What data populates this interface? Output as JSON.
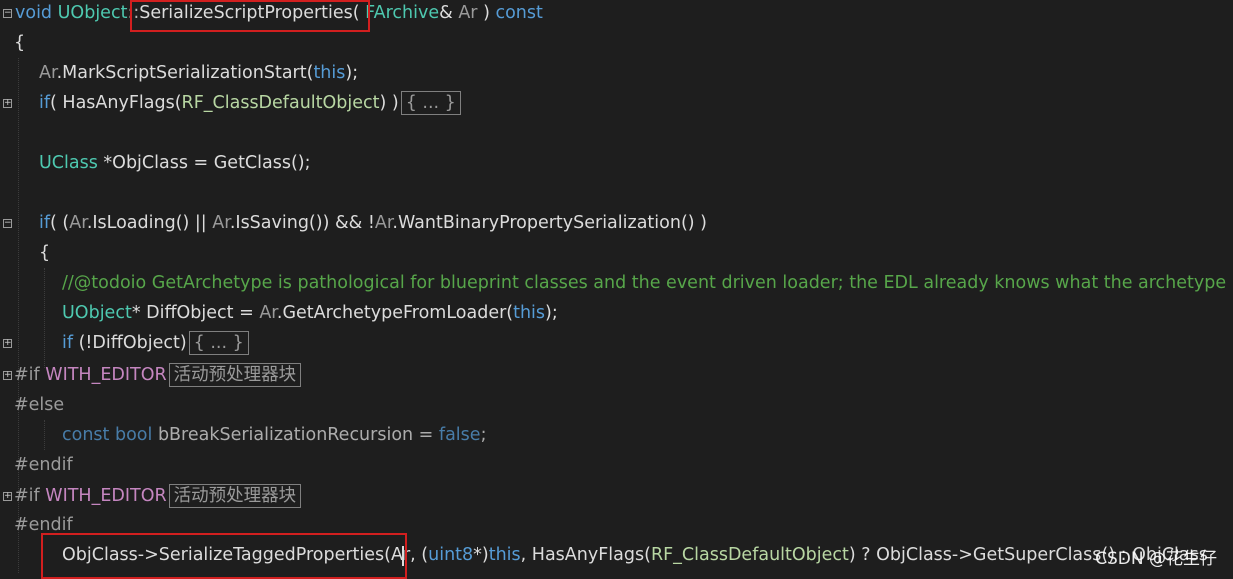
{
  "lines": {
    "l1": {
      "void": "void",
      "class": "UObject",
      "sep": "::",
      "method": "SerializeScriptProperties",
      "open": "( ",
      "ptype": "FArchive",
      "amp": "& ",
      "param": "Ar",
      "close": " ) ",
      "const": "const"
    },
    "l2": {
      "brace": "{"
    },
    "l3": {
      "obj": "Ar",
      "call": ".MarkScriptSerializationStart(",
      "this": "this",
      "end": ");"
    },
    "l4": {
      "if": "if",
      "open": "( HasAnyFlags(",
      "flag": "RF_ClassDefaultObject",
      "close": ") )",
      "collapsed": "{ ... }"
    },
    "l5": {
      "type": "UClass",
      "rest": " *ObjClass = GetClass();"
    },
    "l6": {
      "if": "if",
      "a": "( (",
      "ar1": "Ar",
      "b": ".IsLoading() || ",
      "ar2": "Ar",
      "c": ".IsSaving()) && !",
      "ar3": "Ar",
      "d": ".WantBinaryPropertySerialization() )"
    },
    "l7": {
      "brace": "{"
    },
    "l8": {
      "comment": "//@todoio GetArchetype is pathological for blueprint classes and the event driven loader; the EDL already knows what the archetype is"
    },
    "l9": {
      "type": "UObject",
      "a": "* DiffObject = ",
      "ar": "Ar",
      "b": ".GetArchetypeFromLoader(",
      "this": "this",
      "c": ");"
    },
    "l10": {
      "if": "if",
      "rest": " (!DiffObject)",
      "collapsed": "{ ... }"
    },
    "l11": {
      "directive": "#if",
      "macro": "WITH_EDITOR",
      "collapsed": "活动预处理器块"
    },
    "l12": {
      "directive": "#else"
    },
    "l13": {
      "const": "const",
      "bool": "bool",
      "name": " bBreakSerializationRecursion = ",
      "false": "false",
      "end": ";"
    },
    "l14": {
      "directive": "#endif"
    },
    "l15": {
      "directive": "#if",
      "macro": "WITH_EDITOR",
      "collapsed": "活动预处理器块"
    },
    "l16": {
      "directive": "#endif"
    },
    "l17": {
      "a": "ObjClass->SerializeTaggedProperties",
      "b": "(Ar, (",
      "uint8": "uint8",
      "c": "*)",
      "this": "this",
      "d": ", HasAnyFlags(",
      "flag": "RF_ClassDefaultObject",
      "e": ") ? ObjClass->GetSuperClass() : ObjClass"
    }
  },
  "fold_markers": {
    "minus": "⊟",
    "plus": "⊞"
  },
  "watermark": "CSDN @花生仔",
  "colors": {
    "keyword": "#569cd6",
    "type": "#4ec9b0",
    "comment": "#57a64a",
    "macro": "#c586c0",
    "highlight": "#d21f1f",
    "background": "#1e1e1e"
  }
}
